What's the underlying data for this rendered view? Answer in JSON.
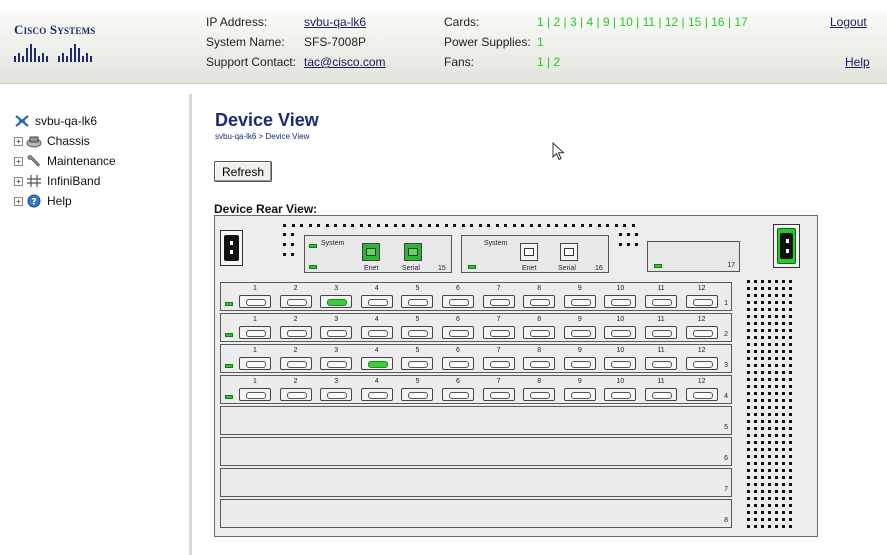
{
  "brand": {
    "name": "Cisco Systems"
  },
  "header": {
    "ip_label": "IP Address:",
    "ip_value": "svbu-qa-lk6",
    "sysname_label": "System Name:",
    "sysname_value": "SFS-7008P",
    "support_label": "Support Contact:",
    "support_value": "tac@cisco.com",
    "cards_label": "Cards:",
    "cards": [
      "1",
      "2",
      "3",
      "4",
      "9",
      "10",
      "11",
      "12",
      "15",
      "16",
      "17"
    ],
    "power_label": "Power Supplies:",
    "power": [
      "1"
    ],
    "fans_label": "Fans:",
    "fans": [
      "1",
      "2"
    ],
    "logout": "Logout",
    "help": "Help"
  },
  "nav": {
    "root": "svbu-qa-lk6",
    "items": [
      {
        "label": "Chassis",
        "icon": "chassis-icon"
      },
      {
        "label": "Maintenance",
        "icon": "wrench-icon"
      },
      {
        "label": "InfiniBand",
        "icon": "grid-icon"
      },
      {
        "label": "Help",
        "icon": "question-icon"
      }
    ]
  },
  "main": {
    "title": "Device View",
    "breadcrumb": "svbu-qa-lk6 > Device View",
    "refresh": "Refresh",
    "rear_title": "Device Rear View:"
  },
  "chassis": {
    "mgmt_cards": [
      {
        "system": "System",
        "enet": "Enet",
        "serial": "Serial",
        "num": "15",
        "enet_active": true,
        "serial_active": true
      },
      {
        "system": "System",
        "enet": "Enet",
        "serial": "Serial",
        "num": "16",
        "enet_active": false,
        "serial_active": false
      }
    ],
    "card17": "17",
    "port_numbers": [
      "1",
      "2",
      "3",
      "4",
      "5",
      "6",
      "7",
      "8",
      "9",
      "10",
      "11",
      "12"
    ],
    "slots": [
      {
        "num": "1",
        "populated": true,
        "active_ports": [
          3
        ]
      },
      {
        "num": "2",
        "populated": true,
        "active_ports": []
      },
      {
        "num": "3",
        "populated": true,
        "active_ports": [
          4
        ]
      },
      {
        "num": "4",
        "populated": true,
        "active_ports": []
      },
      {
        "num": "5",
        "populated": false,
        "active_ports": []
      },
      {
        "num": "6",
        "populated": false,
        "active_ports": []
      },
      {
        "num": "7",
        "populated": false,
        "active_ports": []
      },
      {
        "num": "8",
        "populated": false,
        "active_ports": []
      }
    ],
    "colors": {
      "led_green": "#2ac52a",
      "power_green": "#22cc22",
      "title_blue": "#1a2a7a"
    }
  }
}
